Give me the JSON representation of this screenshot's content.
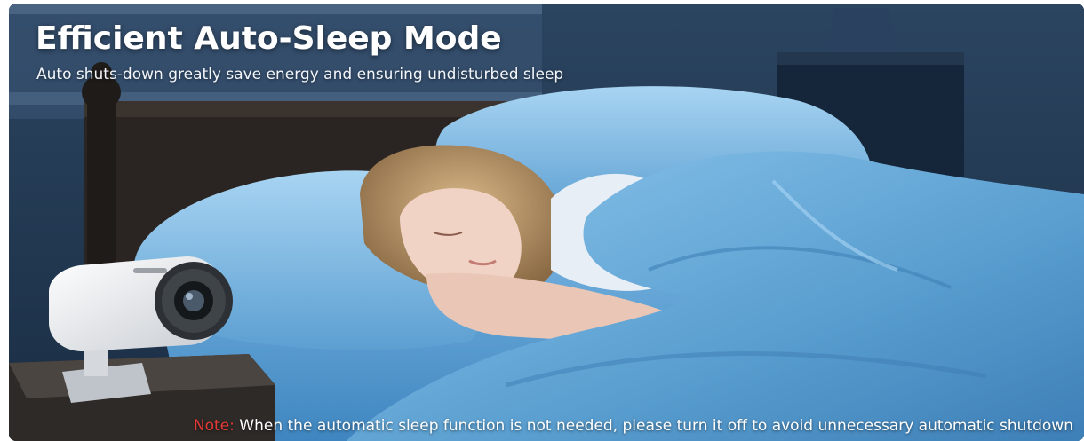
{
  "banner": {
    "headline": "Efficient Auto-Sleep Mode",
    "subhead": "Auto shuts-down greatly save energy and ensuring undisturbed sleep",
    "note_label": "Note:",
    "note_text": " When the automatic sleep function is not needed, please turn it off to avoid unnecessary automatic shutdown"
  },
  "colors": {
    "room": "#1d3550",
    "bedding": "#5a9fd0",
    "note_label": "#e53935",
    "headline": "#ffffff"
  },
  "icons": {
    "projector": "projector-icon"
  }
}
